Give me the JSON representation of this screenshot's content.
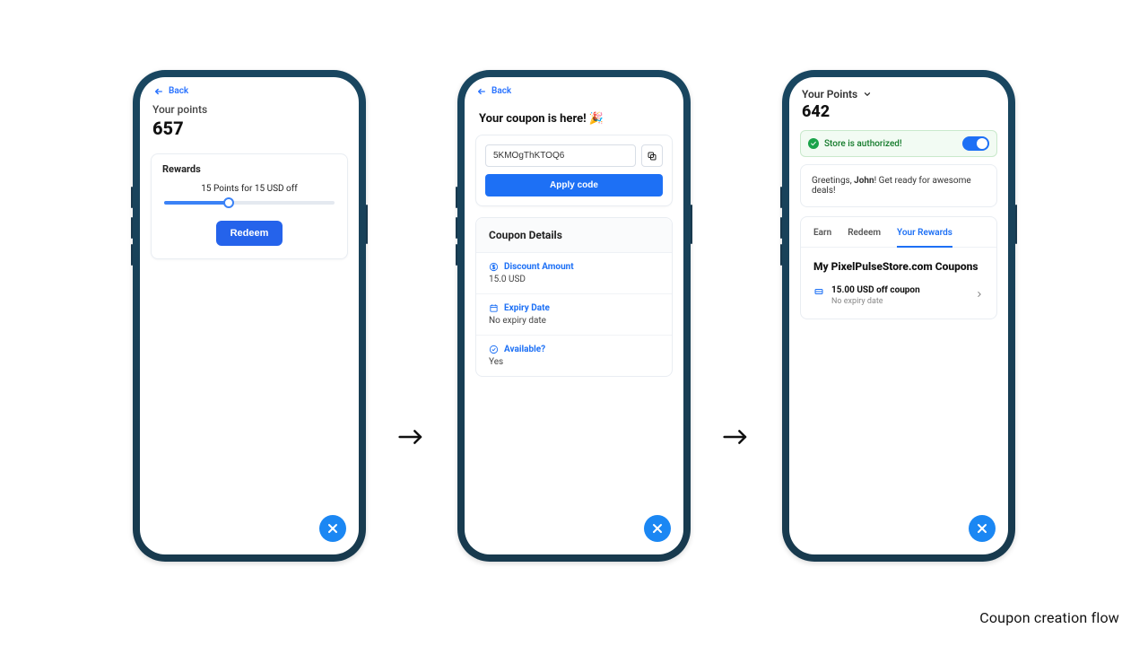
{
  "caption": "Coupon creation flow",
  "screen1": {
    "back": "Back",
    "points_label": "Your points",
    "points_value": "657",
    "rewards_title": "Rewards",
    "slider_text": "15 Points for 15 USD off",
    "redeem_label": "Redeem"
  },
  "screen2": {
    "back": "Back",
    "heading": "Your coupon is here! 🎉",
    "code": "5KMOgThKTOQ6",
    "apply_label": "Apply code",
    "details_title": "Coupon Details",
    "rows": {
      "discount_k": "Discount Amount",
      "discount_v": "15.0 USD",
      "expiry_k": "Expiry Date",
      "expiry_v": "No expiry date",
      "available_k": "Available?",
      "available_v": "Yes"
    }
  },
  "screen3": {
    "points_label": "Your Points",
    "points_value": "642",
    "auth_text": "Store is authorized!",
    "greeting_prefix": "Greetings, ",
    "greeting_name": "John",
    "greeting_suffix": "! Get ready for awesome deals!",
    "tabs": {
      "earn": "Earn",
      "redeem": "Redeem",
      "rewards": "Your Rewards"
    },
    "coupons_heading": "My PixelPulseStore.com Coupons",
    "coupon": {
      "title": "15.00 USD off coupon",
      "sub": "No expiry date"
    }
  }
}
